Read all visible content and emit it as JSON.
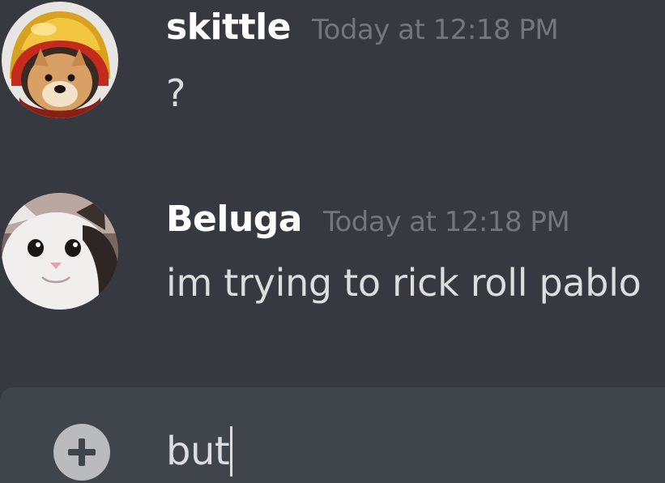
{
  "messages": [
    {
      "username": "skittle",
      "timestamp": "Today at 12:18 PM",
      "content": "?",
      "avatar_icon": "dog-astronaut-helmet-avatar"
    },
    {
      "username": "Beluga",
      "timestamp": "Today at 12:18 PM",
      "content": "im trying to rick roll pablo",
      "avatar_icon": "cat-avatar"
    }
  ],
  "composer": {
    "attach_icon": "plus-circle-icon",
    "value": "but"
  },
  "colors": {
    "background": "#36393f",
    "composer_background": "#40444b",
    "username": "#ffffff",
    "timestamp": "#72767d",
    "message_text": "#dcddde"
  }
}
